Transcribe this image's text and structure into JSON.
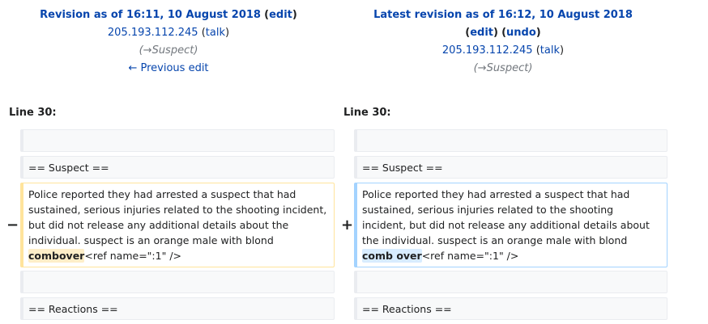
{
  "left_header": {
    "title": "Revision as of 16:11, 10 August 2018",
    "edit_label": "edit",
    "user": "205.193.112.245",
    "talk_label": "talk",
    "summary_arrow": "→",
    "summary": "Suspect",
    "prev_edit_label": "← Previous edit"
  },
  "right_header": {
    "title": "Latest revision as of 16:12, 10 August 2018",
    "edit_label": "edit",
    "undo_label": "undo",
    "user": "205.193.112.245",
    "talk_label": "talk",
    "summary_arrow": "→",
    "summary": "Suspect"
  },
  "diff": {
    "left_line": "Line 30:",
    "right_line": "Line 30:",
    "heading_suspect": "== Suspect ==",
    "heading_reactions": "== Reactions ==",
    "deleted_marker": "−",
    "added_marker": "+",
    "left_text_before": "Police reported they had arrested a suspect that had sustained, serious injuries related to the shooting incident, but did not release any additional details about the individual. suspect is an orange male with blond ",
    "left_changed": "combover",
    "left_text_after": "<ref name=\":1\" />",
    "right_text_before": "Police reported they had arrested a suspect that had sustained, serious injuries related to the shooting incident, but did not release any additional details about the individual. suspect is an orange male with blond ",
    "right_changed": "comb over",
    "right_text_after": "<ref name=\":1\" />"
  },
  "colors": {
    "link": "#0645ad",
    "deleted_border": "#ffe49c",
    "added_border": "#a3d3ff",
    "deleted_highlight": "#feeec8",
    "added_highlight": "#d8ecff"
  }
}
